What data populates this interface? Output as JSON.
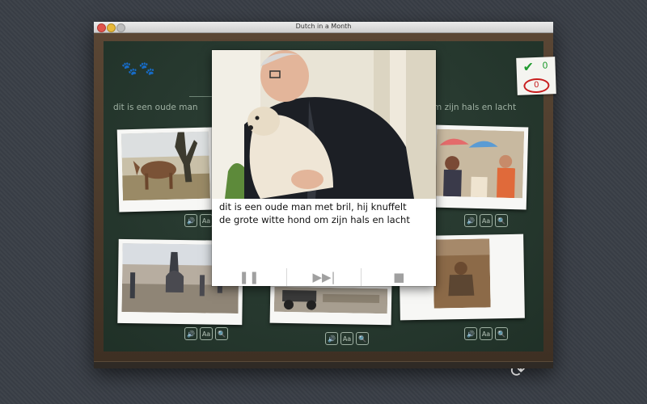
{
  "window": {
    "title": "Dutch in a Month"
  },
  "board": {
    "left_text": "dit is een oude man",
    "right_text": "m zijn hals en lacht"
  },
  "score": {
    "correct": "0",
    "wrong": "0"
  },
  "popup": {
    "line1": "dit is een oude man met bril, hij knuffelt",
    "line2": "de grote witte hond om zijn hals en lacht"
  },
  "controls": {
    "pause": "pause-icon",
    "skip": "skip-icon",
    "stop": "stop-icon"
  },
  "icons": {
    "paw": "paw-icon",
    "speaker": "speaker-icon",
    "text_size": "Aa",
    "zoom": "magnifier-icon",
    "refresh": "refresh-icon"
  },
  "colors": {
    "board": "#25392e",
    "chalk": "#9fb1a3",
    "frame": "#4a3b2c",
    "correct": "#1f9a2e",
    "wrong": "#c81e1e"
  }
}
